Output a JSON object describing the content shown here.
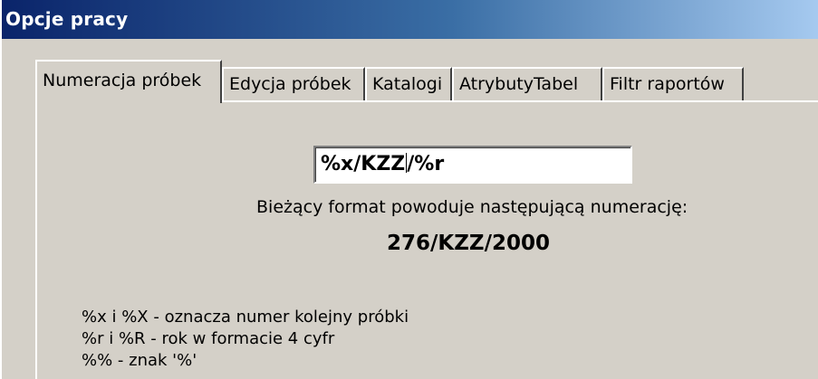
{
  "window": {
    "title": "Opcje pracy"
  },
  "tabs": [
    {
      "label": "Numeracja próbek",
      "active": true
    },
    {
      "label": "Edycja próbek",
      "active": false
    },
    {
      "label": "Katalogi",
      "active": false
    },
    {
      "label": "AtrybutyTabel",
      "active": false
    },
    {
      "label": "Filtr raportów",
      "active": false
    }
  ],
  "format": {
    "value_before_caret": "%x/KZZ",
    "value_after_caret": "/%r"
  },
  "description": "Bieżący format powoduje następującą numerację:",
  "result": "276/KZZ/2000",
  "hints": [
    "%x i %X - oznacza numer kolejny próbki",
    "%r i %R - rok w formacie 4 cyfr",
    "%% - znak '%'"
  ]
}
